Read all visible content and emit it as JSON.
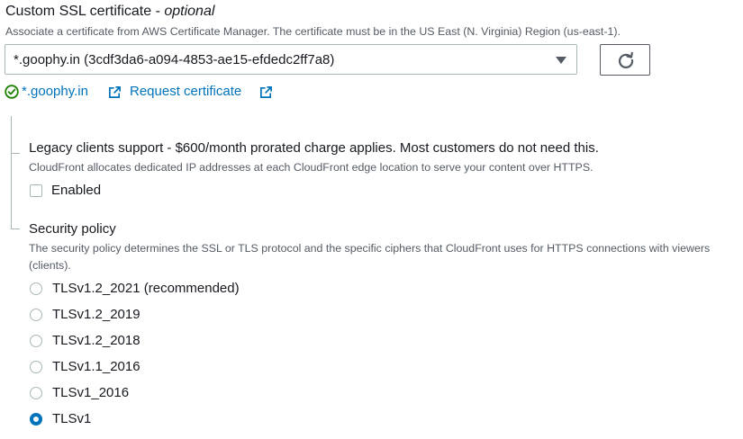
{
  "ssl": {
    "title": "Custom SSL certificate - ",
    "title_optional": "optional",
    "description": "Associate a certificate from AWS Certificate Manager. The certificate must be in the US East (N. Virginia) Region (us-east-1).",
    "selected_certificate": "*.goophy.in (3cdf3da6-a094-4853-ae15-efdedc2ff7a8)",
    "status_cert_link": "*.goophy.in",
    "request_link": "Request certificate",
    "status_color": "#1d8102",
    "link_color": "#0073bb"
  },
  "legacy": {
    "title": "Legacy clients support - $600/month prorated charge applies. Most customers do not need this.",
    "description": "CloudFront allocates dedicated IP addresses at each CloudFront edge location to serve your content over HTTPS.",
    "checkbox_label": "Enabled",
    "checked": false
  },
  "security_policy": {
    "title": "Security policy",
    "description": "The security policy determines the SSL or TLS protocol and the specific ciphers that CloudFront uses for HTTPS connections with viewers (clients).",
    "options": [
      {
        "label": "TLSv1.2_2021 (recommended)",
        "selected": false
      },
      {
        "label": "TLSv1.2_2019",
        "selected": false
      },
      {
        "label": "TLSv1.2_2018",
        "selected": false
      },
      {
        "label": "TLSv1.1_2016",
        "selected": false
      },
      {
        "label": "TLSv1_2016",
        "selected": false
      },
      {
        "label": "TLSv1",
        "selected": true
      }
    ]
  },
  "icons": {
    "caret": "caret-down-icon",
    "refresh": "refresh-icon",
    "check": "check-circle-icon",
    "external": "external-link-icon"
  }
}
